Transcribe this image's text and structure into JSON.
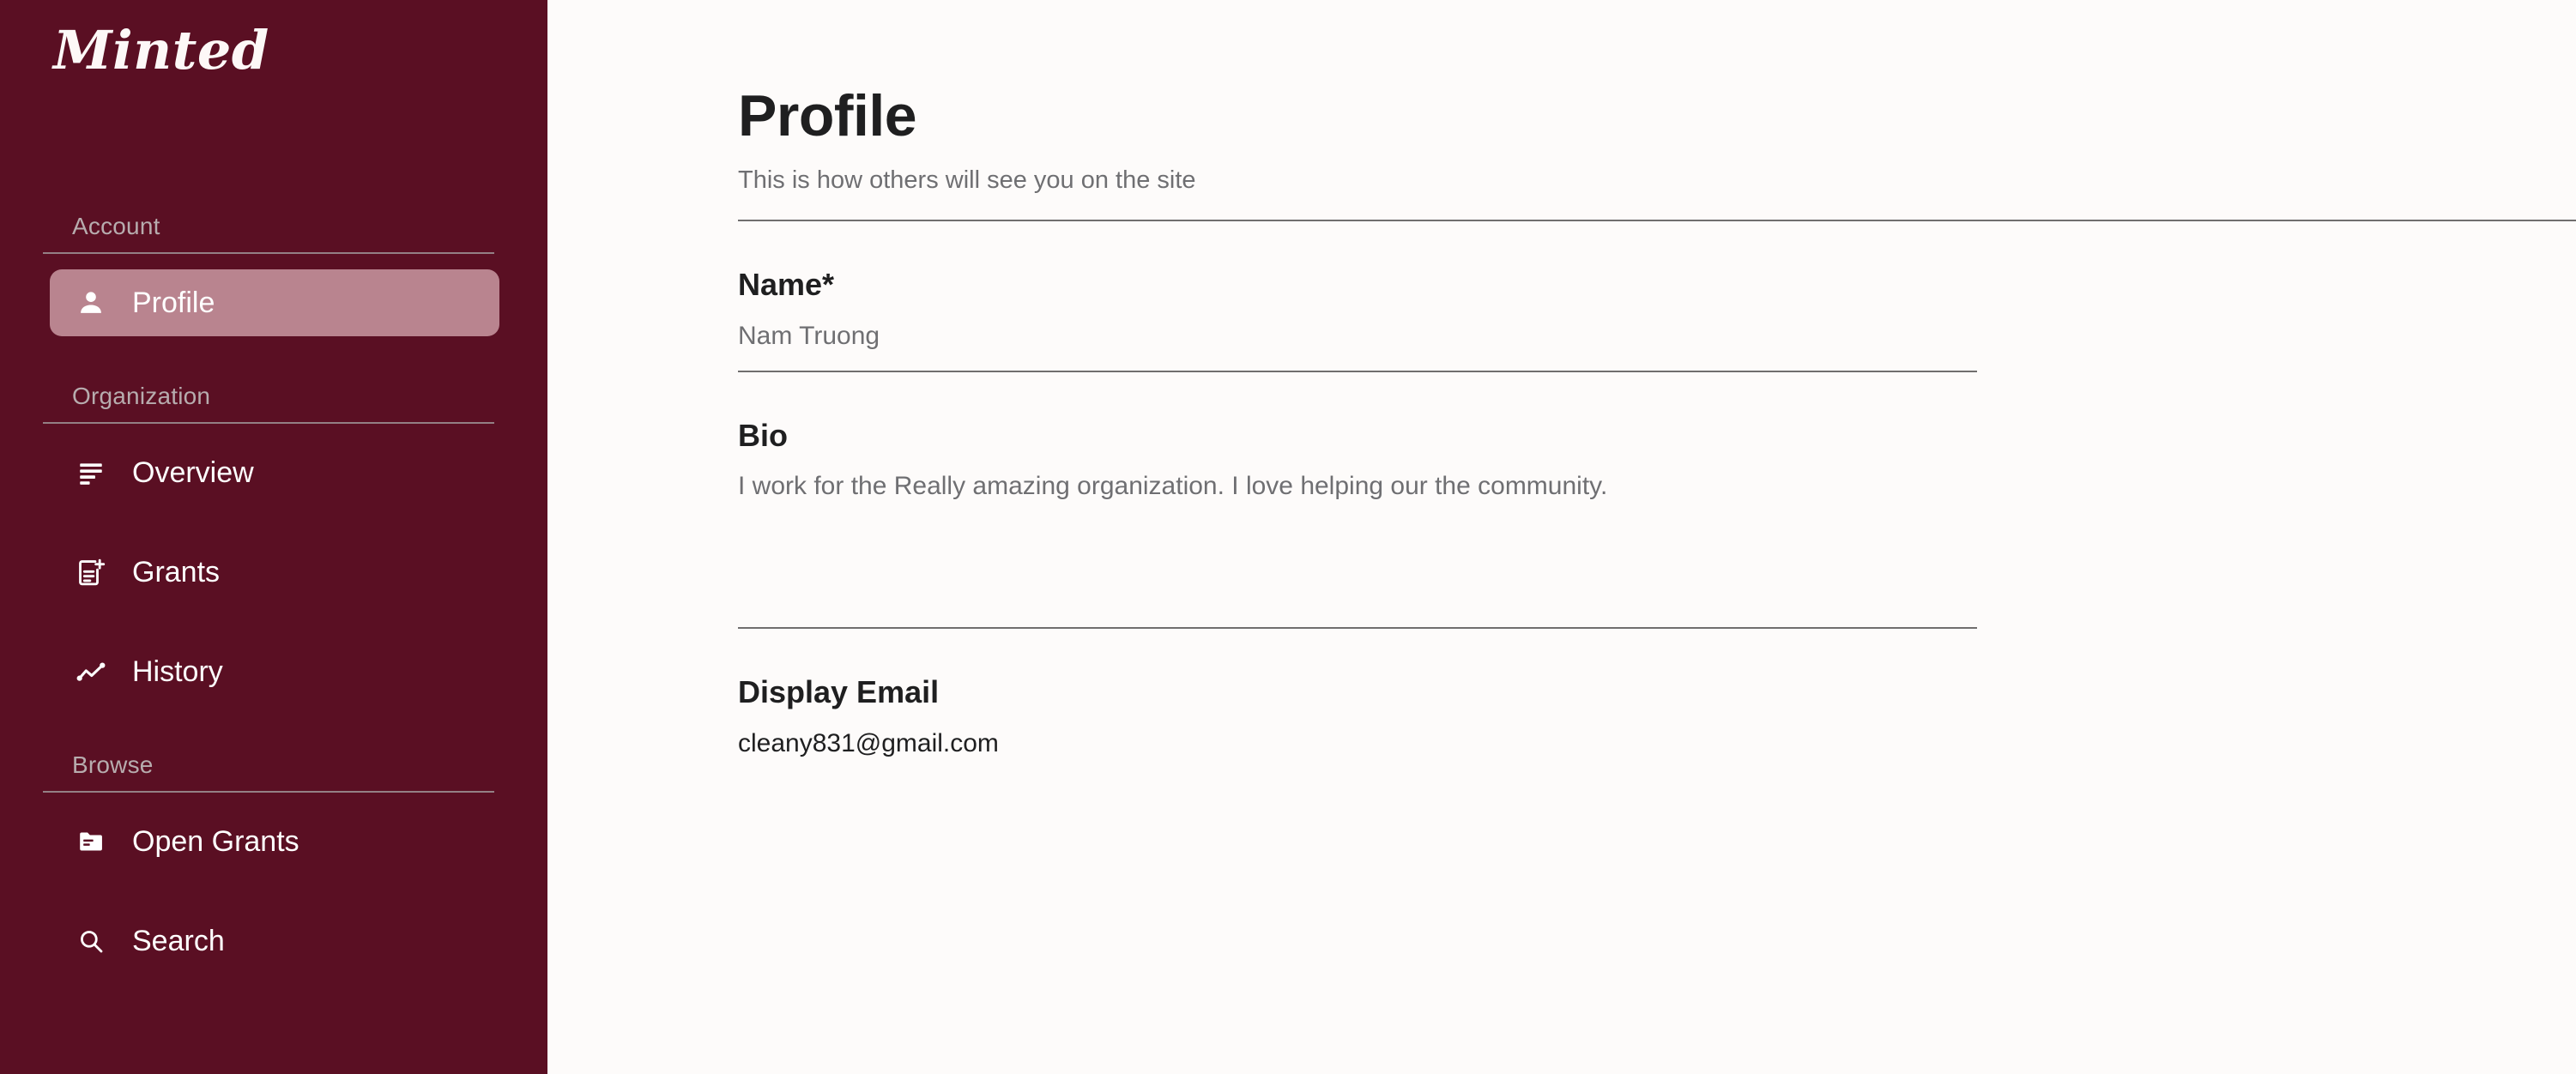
{
  "brand": {
    "name": "Minted"
  },
  "sidebar": {
    "sections": [
      {
        "label": "Account",
        "items": [
          {
            "label": "Profile",
            "icon": "person-icon",
            "active": true
          }
        ]
      },
      {
        "label": "Organization",
        "items": [
          {
            "label": "Overview",
            "icon": "list-lines-icon",
            "active": false
          },
          {
            "label": "Grants",
            "icon": "document-plus-icon",
            "active": false
          },
          {
            "label": "History",
            "icon": "line-chart-icon",
            "active": false
          }
        ]
      },
      {
        "label": "Browse",
        "items": [
          {
            "label": "Open Grants",
            "icon": "folder-icon",
            "active": false
          },
          {
            "label": "Search",
            "icon": "search-icon",
            "active": false
          }
        ]
      }
    ]
  },
  "page": {
    "title": "Profile",
    "subtitle": "This is how others will see you on the site"
  },
  "form": {
    "name": {
      "label": "Name*",
      "value": "Nam Truong"
    },
    "bio": {
      "label": "Bio",
      "value": "I work for the Really amazing organization. I love helping our the community."
    },
    "display_email": {
      "label": "Display Email",
      "value": "cleany831@gmail.com"
    }
  },
  "colors": {
    "sidebar_bg": "#5a0f23",
    "active_item_bg": "#b9848f",
    "page_bg": "#fdfbfa",
    "rule": "#706e6e",
    "muted_text": "#6f6f72",
    "section_label": "#b7acae"
  }
}
